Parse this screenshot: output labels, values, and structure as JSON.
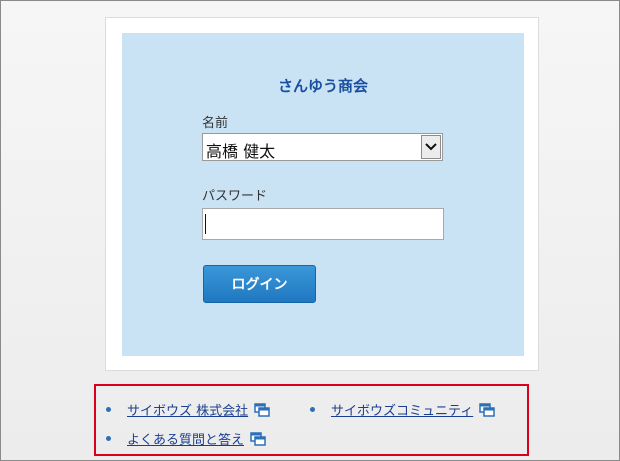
{
  "login": {
    "company_name": "さんゆう商会",
    "name_label": "名前",
    "name_selected": "高橋 健太",
    "password_label": "パスワード",
    "password_value": "",
    "login_button": "ログイン"
  },
  "links": [
    {
      "label": "サイボウズ 株式会社"
    },
    {
      "label": "サイボウズコミュニティ"
    },
    {
      "label": "よくある質問と答え"
    }
  ],
  "colors": {
    "panel_bg": "#c9e3f5",
    "accent": "#1f78c1",
    "highlight_border": "#d9001b",
    "title": "#1a4fa0"
  },
  "icons": {
    "select_arrow": "chevron-down-icon",
    "external_link": "new-window-icon"
  }
}
